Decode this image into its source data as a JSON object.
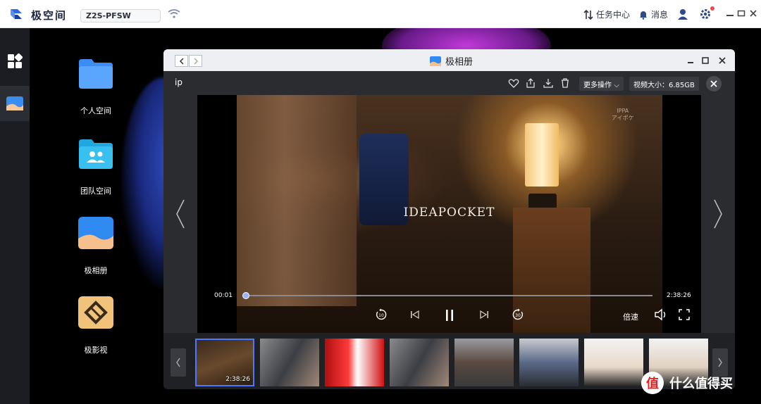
{
  "topbar": {
    "brand": "极空间",
    "device_name": "Z2S-PFSW",
    "task_center": "任务中心",
    "messages": "消息"
  },
  "desktop": {
    "apps": [
      {
        "label": "个人空间"
      },
      {
        "label": "团队空间"
      },
      {
        "label": "极相册"
      },
      {
        "label": "极影视"
      }
    ]
  },
  "window": {
    "title": "极相册",
    "file_name": "ip",
    "more_actions": "更多操作",
    "video_size": "视频大小：6.85GB"
  },
  "player": {
    "current_time": "00:01",
    "total_time": "2:38:26",
    "progress": 0.005,
    "speed_label": "倍速",
    "watermark": "IDEAPOCKET",
    "corner_logo_line1": "IPPA",
    "corner_logo_line2": "アイポケ"
  },
  "filmstrip": {
    "items": [
      {
        "label": "2:38:26",
        "selected": true
      },
      {
        "label": ""
      },
      {
        "label": ""
      },
      {
        "label": ""
      },
      {
        "label": ""
      },
      {
        "label": ""
      },
      {
        "label": ""
      },
      {
        "label": ""
      }
    ]
  },
  "watermark_site": "什么值得买",
  "watermark_glyph": "值",
  "colors": {
    "accent": "#4e78ff",
    "brand_blue": "#2d6be4",
    "topbar_text": "#1b2440"
  }
}
